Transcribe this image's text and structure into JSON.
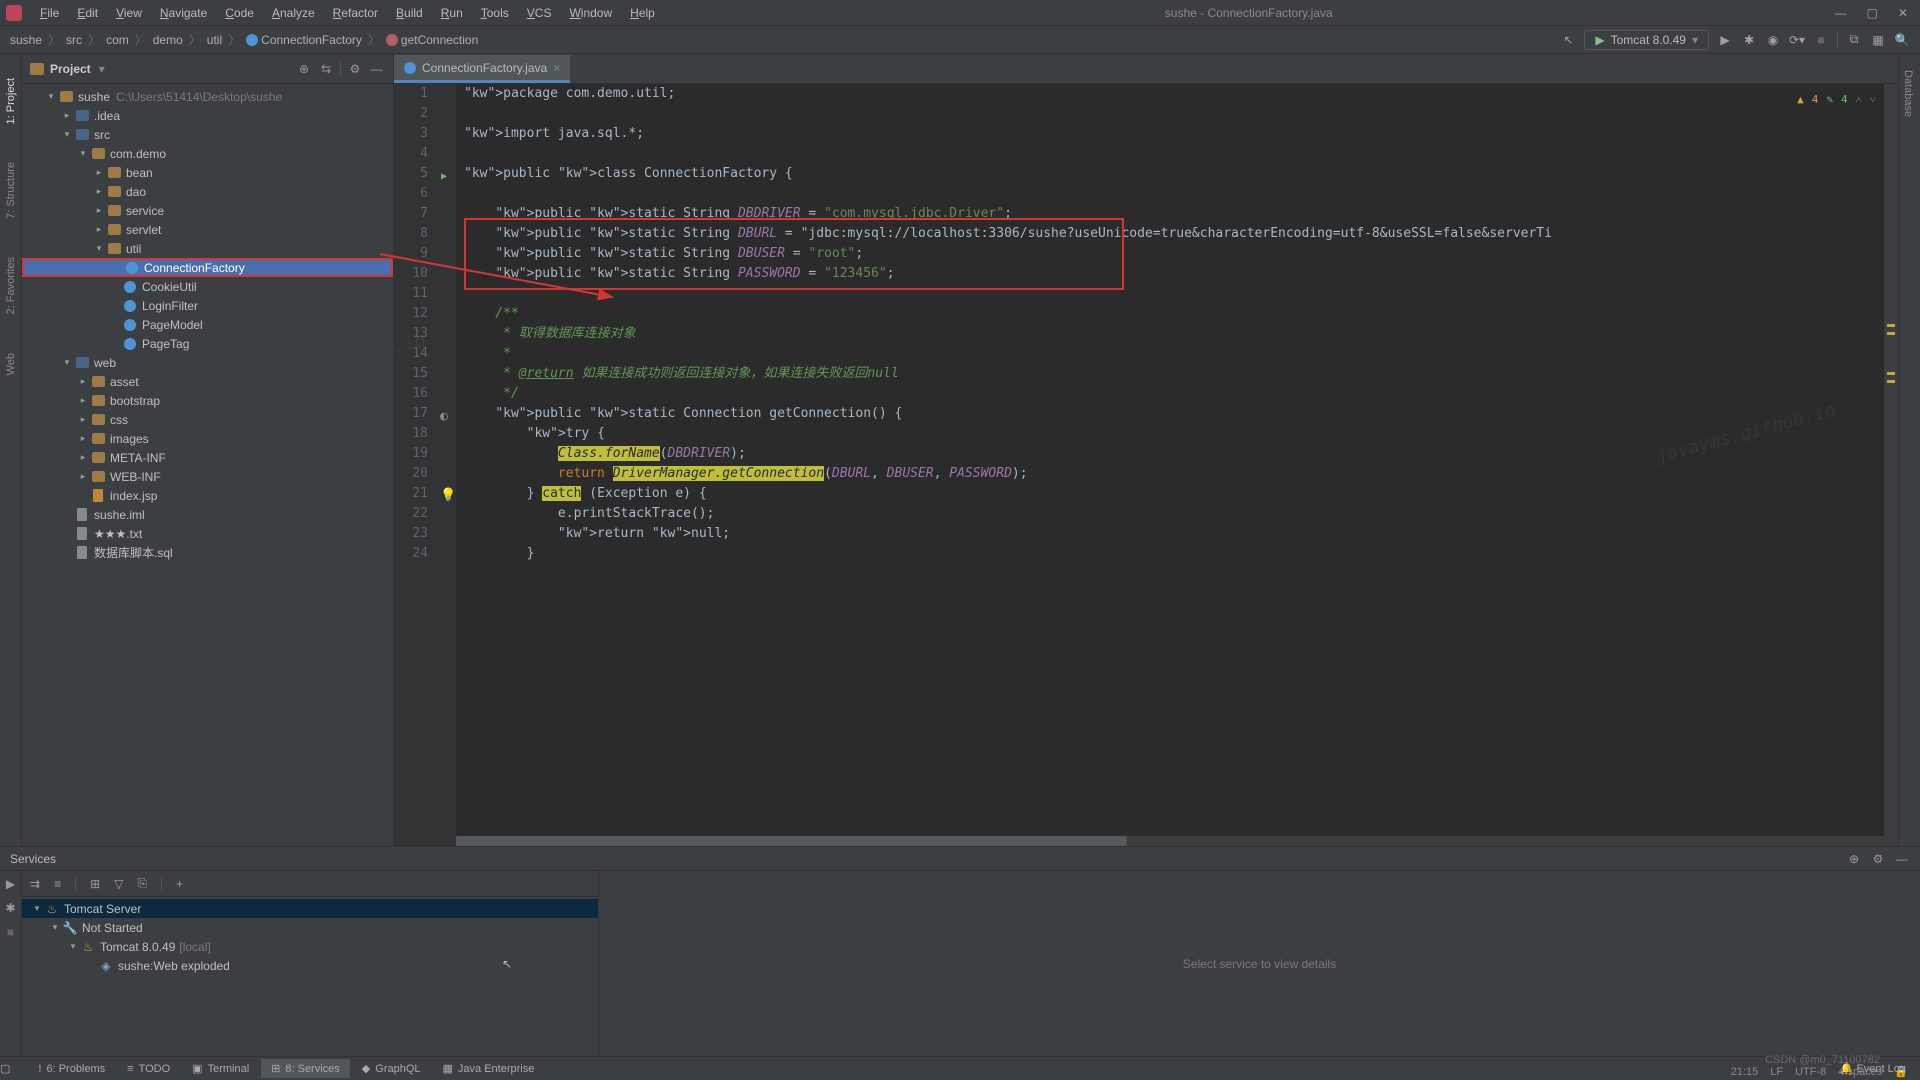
{
  "window": {
    "title": "sushe - ConnectionFactory.java",
    "menus": [
      "File",
      "Edit",
      "View",
      "Navigate",
      "Code",
      "Analyze",
      "Refactor",
      "Build",
      "Run",
      "Tools",
      "VCS",
      "Window",
      "Help"
    ]
  },
  "breadcrumbs": [
    "sushe",
    "src",
    "com",
    "demo",
    "util",
    "ConnectionFactory",
    "getConnection"
  ],
  "runConfig": "Tomcat 8.0.49",
  "leftTabs": [
    "1: Project",
    "7: Structure",
    "2: Favorites",
    "Web"
  ],
  "rightTabs": [
    "Database"
  ],
  "project": {
    "title": "Project",
    "root": {
      "name": "sushe",
      "path": "C:\\Users\\51414\\Desktop\\sushe"
    },
    "items": [
      {
        "d": 1,
        "exp": "v",
        "ico": "dir",
        "name": "sushe",
        "extra": "C:\\Users\\51414\\Desktop\\sushe"
      },
      {
        "d": 2,
        "exp": ">",
        "ico": "dir special",
        "name": ".idea"
      },
      {
        "d": 2,
        "exp": "v",
        "ico": "dir special",
        "name": "src"
      },
      {
        "d": 3,
        "exp": "v",
        "ico": "dir",
        "name": "com.demo"
      },
      {
        "d": 4,
        "exp": ">",
        "ico": "dir",
        "name": "bean"
      },
      {
        "d": 4,
        "exp": ">",
        "ico": "dir",
        "name": "dao"
      },
      {
        "d": 4,
        "exp": ">",
        "ico": "dir",
        "name": "service"
      },
      {
        "d": 4,
        "exp": ">",
        "ico": "dir",
        "name": "servlet"
      },
      {
        "d": 4,
        "exp": "v",
        "ico": "dir",
        "name": "util"
      },
      {
        "d": 5,
        "exp": " ",
        "ico": "class",
        "name": "ConnectionFactory",
        "sel": true,
        "redbox": true
      },
      {
        "d": 5,
        "exp": " ",
        "ico": "class",
        "name": "CookieUtil"
      },
      {
        "d": 5,
        "exp": " ",
        "ico": "class",
        "name": "LoginFilter"
      },
      {
        "d": 5,
        "exp": " ",
        "ico": "class",
        "name": "PageModel"
      },
      {
        "d": 5,
        "exp": " ",
        "ico": "class",
        "name": "PageTag"
      },
      {
        "d": 2,
        "exp": "v",
        "ico": "dir special",
        "name": "web"
      },
      {
        "d": 3,
        "exp": ">",
        "ico": "dir",
        "name": "asset"
      },
      {
        "d": 3,
        "exp": ">",
        "ico": "dir",
        "name": "bootstrap"
      },
      {
        "d": 3,
        "exp": ">",
        "ico": "dir",
        "name": "css"
      },
      {
        "d": 3,
        "exp": ">",
        "ico": "dir",
        "name": "images"
      },
      {
        "d": 3,
        "exp": ">",
        "ico": "dir",
        "name": "META-INF"
      },
      {
        "d": 3,
        "exp": ">",
        "ico": "dir",
        "name": "WEB-INF"
      },
      {
        "d": 3,
        "exp": " ",
        "ico": "jsp",
        "name": "index.jsp"
      },
      {
        "d": 2,
        "exp": " ",
        "ico": "file",
        "name": "sushe.iml"
      },
      {
        "d": 2,
        "exp": " ",
        "ico": "file",
        "name": "★★★.txt"
      },
      {
        "d": 2,
        "exp": " ",
        "ico": "file",
        "name": "数据库脚本.sql"
      }
    ]
  },
  "editor": {
    "tab": "ConnectionFactory.java",
    "warnings": "4",
    "hints": "4",
    "lines": [
      "package com.demo.util;",
      "",
      "import java.sql.*;",
      "",
      "public class ConnectionFactory {",
      "",
      "    public static String DBDRIVER = \"com.mysql.jdbc.Driver\";",
      "    public static String DBURL = \"jdbc:mysql://localhost:3306/sushe?useUnicode=true&characterEncoding=utf-8&useSSL=false&serverTi",
      "    public static String DBUSER = \"root\";",
      "    public static String PASSWORD = \"123456\";",
      "",
      "    /**",
      "     * 取得数据库连接对象",
      "     *",
      "     * @return 如果连接成功则返回连接对象，如果连接失败返回null",
      "     */",
      "    public static Connection getConnection() {",
      "        try {",
      "            Class.forName(DBDRIVER);",
      "            return DriverManager.getConnection(DBURL, DBUSER, PASSWORD);",
      "        } catch (Exception e) {",
      "            e.printStackTrace();",
      "            return null;",
      "        }"
    ]
  },
  "services": {
    "title": "Services",
    "emptyMsg": "Select service to view details",
    "tree": [
      {
        "d": 0,
        "exp": "v",
        "name": "Tomcat Server",
        "sel": true,
        "ico": "tomcat"
      },
      {
        "d": 1,
        "exp": "v",
        "name": "Not Started",
        "ico": "wrench"
      },
      {
        "d": 2,
        "exp": "v",
        "name": "Tomcat 8.0.49",
        "gray": "[local]",
        "ico": "tomcat"
      },
      {
        "d": 3,
        "exp": " ",
        "name": "sushe:Web exploded",
        "ico": "artifact"
      }
    ]
  },
  "bottomTabs": [
    {
      "icon": "!",
      "label": "6: Problems"
    },
    {
      "icon": "≡",
      "label": "TODO"
    },
    {
      "icon": "▣",
      "label": "Terminal"
    },
    {
      "icon": "⊞",
      "label": "8: Services",
      "active": true
    },
    {
      "icon": "◆",
      "label": "GraphQL"
    },
    {
      "icon": "▦",
      "label": "Java Enterprise"
    }
  ],
  "status": {
    "eventLog": "Event Log",
    "pos": "21:15",
    "le": "LF",
    "enc": "UTF-8",
    "indent": "4 spaces",
    "csdn": "CSDN @m0_71100782"
  }
}
